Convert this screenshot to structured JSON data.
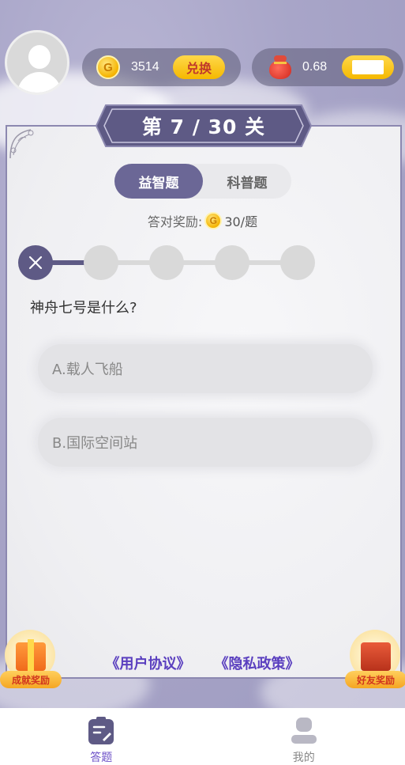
{
  "header": {
    "coins": "3514",
    "exchange_label": "兑换",
    "coin_symbol": "G",
    "red_packet_value": "0.68"
  },
  "level": {
    "title": "第 7 / 30 关"
  },
  "tabs": [
    {
      "label": "益智题",
      "active": true
    },
    {
      "label": "科普题",
      "active": false
    }
  ],
  "reward": {
    "prefix": "答对奖励:",
    "amount": "30/题"
  },
  "progress": {
    "total": 5,
    "answered_wrong": 1
  },
  "question": {
    "text": "神舟七号是什么?",
    "options": [
      {
        "label": "A.载人飞船"
      },
      {
        "label": "B.国际空间站"
      }
    ]
  },
  "footer_links": {
    "user_agreement": "《用户协议》",
    "privacy_policy": "《隐私政策》"
  },
  "badges": {
    "left": "成就奖励",
    "right": "好友奖励"
  },
  "nav": {
    "items": [
      {
        "label": "答题",
        "active": true
      },
      {
        "label": "我的",
        "active": false
      }
    ]
  },
  "colors": {
    "accent": "#6b6796",
    "link": "#5a3fbf",
    "gold": "#f5b800"
  }
}
